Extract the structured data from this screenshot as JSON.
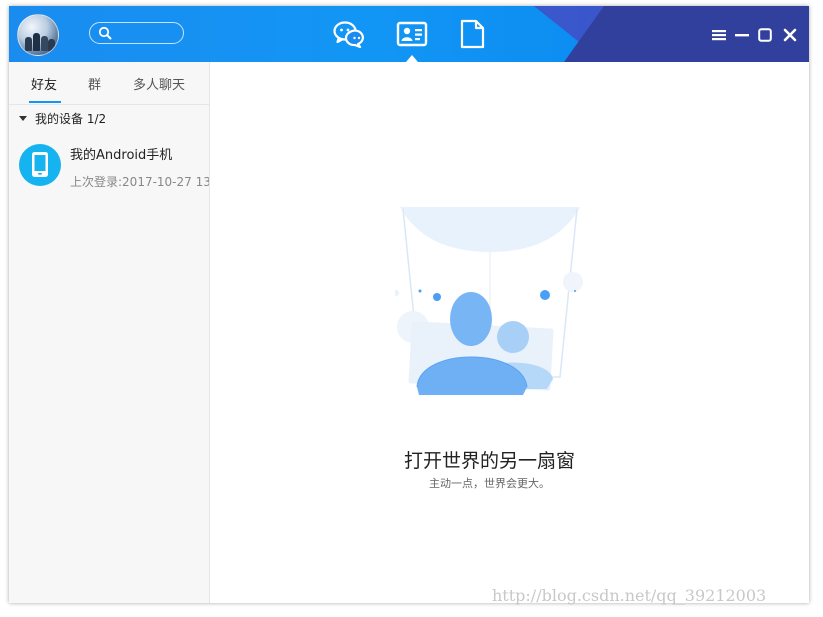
{
  "topbar": {
    "search": {
      "placeholder": ""
    },
    "nav": [
      {
        "name": "messages",
        "icon": "chat-bubbles-icon",
        "active": false
      },
      {
        "name": "contacts",
        "icon": "contact-card-icon",
        "active": true
      },
      {
        "name": "files",
        "icon": "document-icon",
        "active": false
      }
    ],
    "window_controls": [
      "menu-icon",
      "minimize-icon",
      "maximize-icon",
      "close-icon"
    ],
    "colors": {
      "gradient_start": "#1a8cf0",
      "gradient_end": "#303f9f"
    }
  },
  "sidebar": {
    "tabs": [
      {
        "label": "好友",
        "active": true
      },
      {
        "label": "群",
        "active": false
      },
      {
        "label": "多人聊天",
        "active": false
      }
    ],
    "group": {
      "label": "我的设备 1/2",
      "expanded": true
    },
    "devices": [
      {
        "name": "我的Android手机",
        "status": "上次登录:2017-10-27 13",
        "icon": "phone-icon"
      }
    ]
  },
  "main": {
    "empty_state": {
      "title": "打开世界的另一扇窗",
      "subtitle": "主动一点，世界会更大。",
      "illustration": "people-frame-illustration"
    }
  },
  "watermark": "http://blog.csdn.net/qq_39212003",
  "accent_color": "#1296f5"
}
